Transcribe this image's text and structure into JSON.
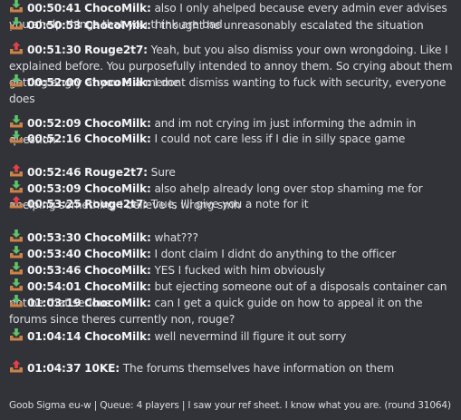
{
  "messages": [
    {
      "direction": "in",
      "time": "00:50:41",
      "user": "ChocoMilk:",
      "text": "also I only ahelped because every admin ever advises you ahelp things that you think are bad"
    },
    {
      "direction": "in",
      "time": "00:50:53",
      "user": "ChocoMilk:",
      "text": "I thought he unreasonably escalated the situation"
    },
    {
      "direction": "out",
      "time": "00:51:30",
      "user": "Rouge2t7:",
      "text": "Yeah, but you also dismiss your own wrongdoing. Like I explained before. You purposefully intended to annoy them. So crying about them getting angry at you is a meme"
    },
    {
      "direction": "in",
      "time": "00:52:00",
      "user": "ChocoMilk:",
      "text": "I dont dismiss wanting to fuck with security, everyone does"
    },
    {
      "direction": "in",
      "time": "00:52:09",
      "user": "ChocoMilk:",
      "text": "and im not crying im just informing the admin in question"
    },
    {
      "direction": "in",
      "time": "00:52:16",
      "user": "ChocoMilk:",
      "text": "I could not care less if I die in silly space game"
    },
    {
      "direction": "out",
      "time": "00:52:46",
      "user": "Rouge2t7:",
      "text": "Sure"
    },
    {
      "direction": "in",
      "time": "00:53:09",
      "user": "ChocoMilk:",
      "text": "also ahelp already long over stop shaming me for ahelping something I believe is wrong smh"
    },
    {
      "direction": "out",
      "time": "00:53:25",
      "user": "Rouge2t7:",
      "text": "True, I'll give you a note for it"
    },
    {
      "direction": "in",
      "time": "00:53:30",
      "user": "ChocoMilk:",
      "text": "what???"
    },
    {
      "direction": "in",
      "time": "00:53:40",
      "user": "ChocoMilk:",
      "text": "I dont claim I didnt do anything to the officer"
    },
    {
      "direction": "in",
      "time": "00:53:46",
      "user": "ChocoMilk:",
      "text": "YES I fucked with him obviously"
    },
    {
      "direction": "in",
      "time": "00:54:01",
      "user": "ChocoMilk:",
      "text": "but ejecting someone out of a disposals container can not be that serious"
    },
    {
      "direction": "in",
      "time": "01:03:19",
      "user": "ChocoMilk:",
      "text": "can I get a quick guide on how to appeal it on the forums since theres currently non, rouge?"
    },
    {
      "direction": "in",
      "time": "01:04:14",
      "user": "ChocoMilk:",
      "text": "well nevermind ill figure it out sorry"
    },
    {
      "direction": "out",
      "time": "01:04:37",
      "user": "10KE:",
      "text": "The forums themselves have information on them"
    }
  ],
  "footer": {
    "text": "Goob Sigma eu-w | Queue: 4 players | I saw your ref sheet. I know what you are. (round 31064)"
  },
  "icons": {
    "in": "inbox-download-icon",
    "out": "inbox-upload-icon"
  },
  "colors": {
    "background": "#313338",
    "text": "#dbdee1",
    "name": "#f2f3f5",
    "arrow_in": "#5ec36a",
    "arrow_out": "#e8404a",
    "tray": "#c8844a"
  }
}
